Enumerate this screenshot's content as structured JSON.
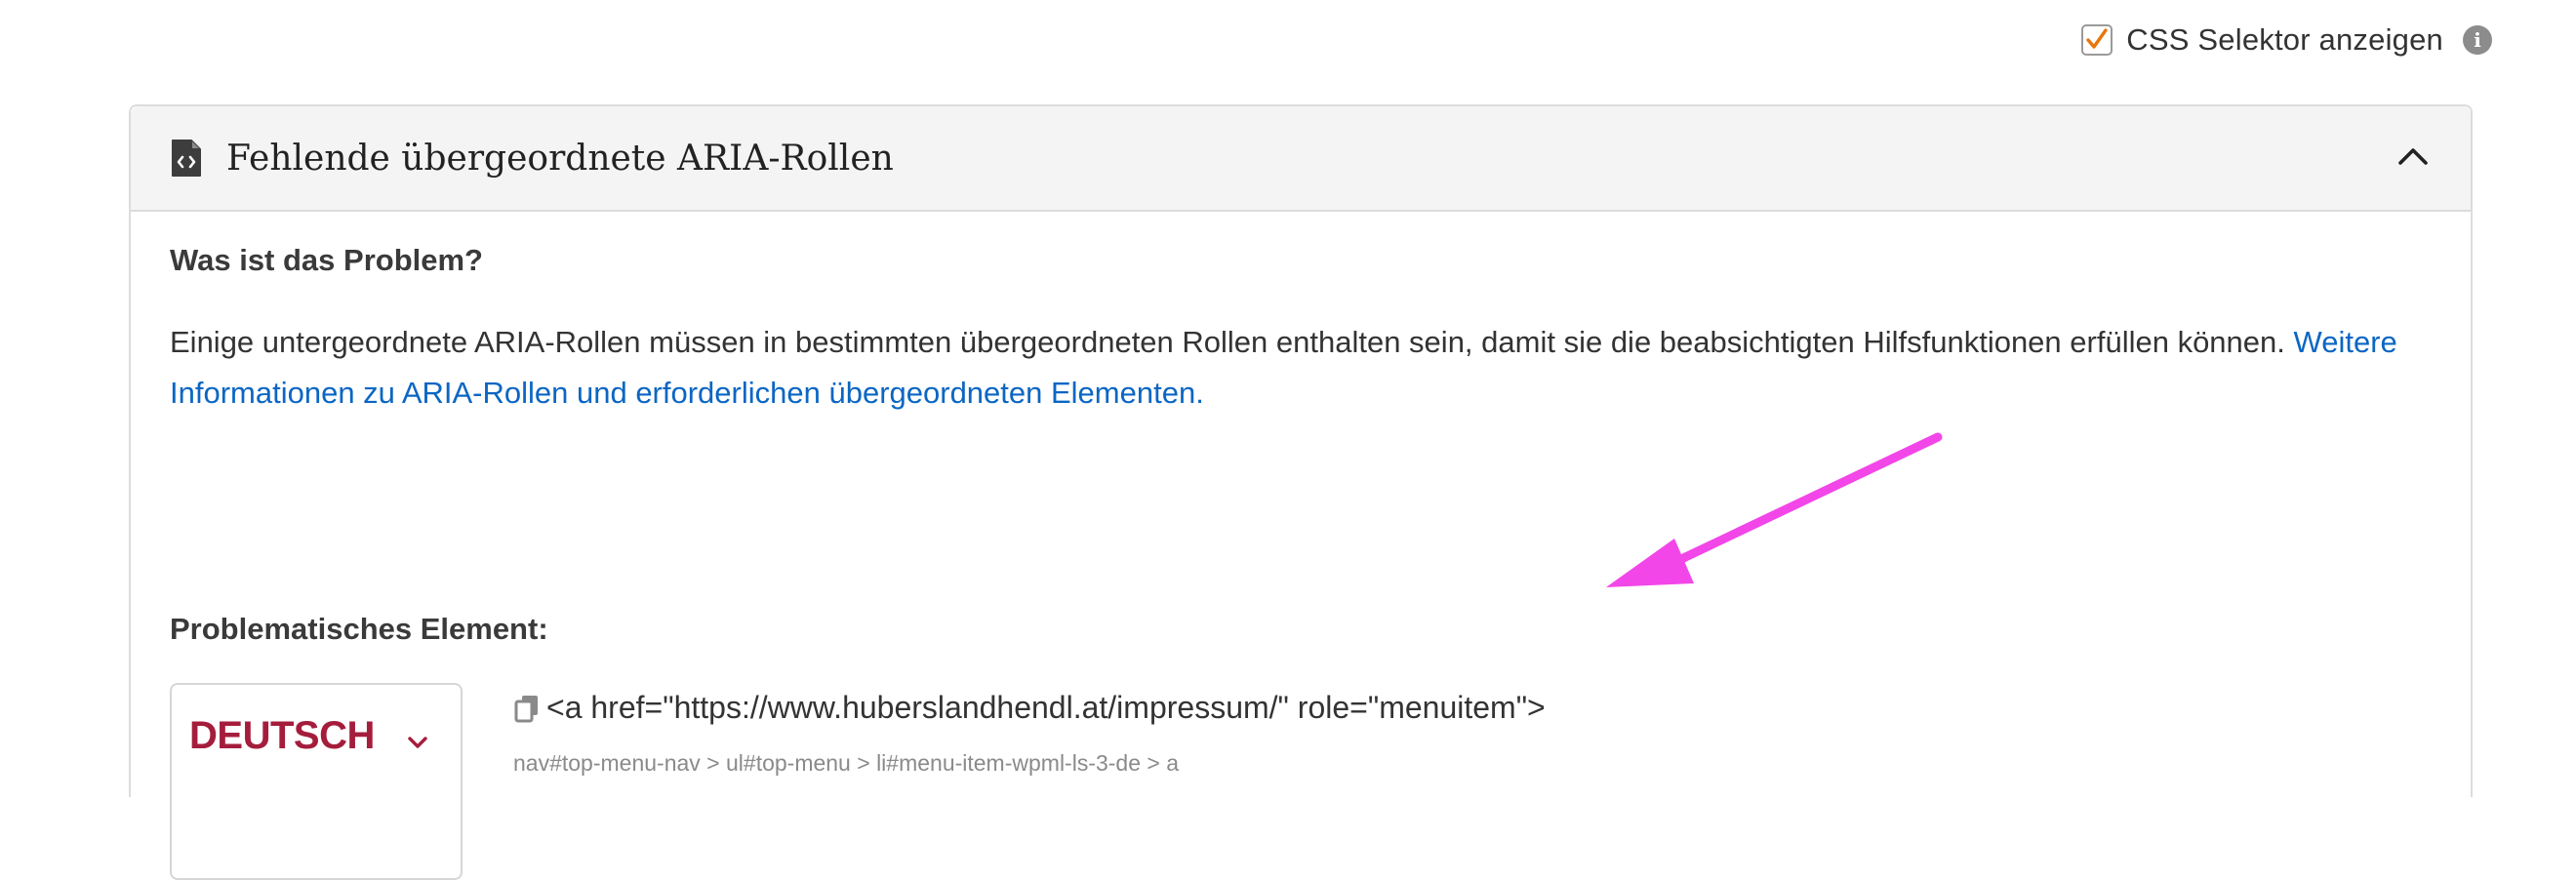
{
  "toggle": {
    "label": "CSS Selektor anzeigen",
    "checked": true,
    "check_color": "#e8760a",
    "info_symbol": "i"
  },
  "issue": {
    "title": "Fehlende übergeordnete ARIA-Rollen",
    "header_icon": "file-code-icon",
    "collapse_icon": "chevron-up-icon",
    "problem_heading": "Was ist das Problem?",
    "description_text": "Einige untergeordnete ARIA-Rollen müssen in bestimmten übergeordneten Rollen enthalten sein, damit sie die beabsichtigten Hilfsfunktionen erfüllen können.",
    "learn_more_link": "Weitere Informationen zu ARIA-Rollen und erforderlichen übergeordneten Elementen.",
    "link_color": "#0b66c3",
    "element_heading": "Problematisches Element:",
    "element": {
      "thumbnail_text": "DEUTSCH",
      "thumbnail_color": "#a51d3c",
      "code": "<a href=\"https://www.huberslandhendl.at/impressum/\" role=\"menuitem\">",
      "selector": "nav#top-menu-nav > ul#top-menu > li#menu-item-wpml-ls-3-de > a"
    }
  },
  "annotation": {
    "arrow_color": "#f246e8"
  }
}
